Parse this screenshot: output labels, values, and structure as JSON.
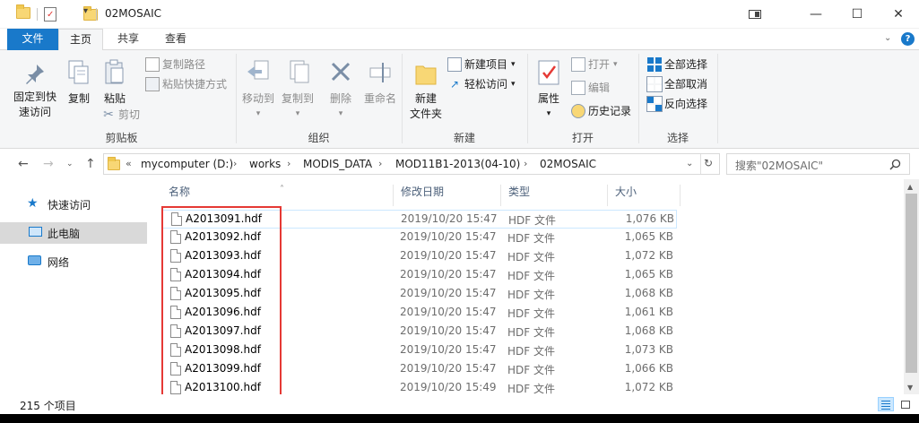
{
  "window": {
    "title": "02MOSAIC",
    "controls": {
      "minimize": "—",
      "maximize": "☐",
      "close": "✕"
    }
  },
  "ribbon_tabs": [
    {
      "label": "文件"
    },
    {
      "label": "主页"
    },
    {
      "label": "共享"
    },
    {
      "label": "查看"
    }
  ],
  "ribbon": {
    "clipboard": {
      "pin": "固定到快\n速访问",
      "pin_line1": "固定到快",
      "pin_line2": "速访问",
      "copy": "复制",
      "paste": "粘贴",
      "copy_path": "复制路径",
      "paste_shortcut": "粘贴快捷方式",
      "cut": "剪切",
      "group": "剪贴板"
    },
    "organize": {
      "move_to": "移动到",
      "copy_to": "复制到",
      "delete": "删除",
      "rename": "重命名",
      "group": "组织"
    },
    "new": {
      "new_folder_line1": "新建",
      "new_folder_line2": "文件夹",
      "new_item": "新建项目",
      "easy_access": "轻松访问",
      "group": "新建"
    },
    "open": {
      "properties": "属性",
      "open": "打开",
      "edit": "编辑",
      "history": "历史记录",
      "group": "打开"
    },
    "select": {
      "select_all": "全部选择",
      "select_none": "全部取消",
      "invert": "反向选择",
      "group": "选择"
    }
  },
  "address": {
    "prefix": "«",
    "crumbs": [
      "mycomputer (D:)",
      "works",
      "MODIS_DATA",
      "MOD11B1-2013(04-10)",
      "02MOSAIC"
    ]
  },
  "search": {
    "placeholder": "搜索\"02MOSAIC\""
  },
  "nav_pane": [
    {
      "label": "快速访问",
      "icon": "star-icon"
    },
    {
      "label": "此电脑",
      "icon": "computer-icon"
    },
    {
      "label": "网络",
      "icon": "network-icon"
    }
  ],
  "columns": {
    "name": "名称",
    "date": "修改日期",
    "type": "类型",
    "size": "大小"
  },
  "files": [
    {
      "name": "A2013091.hdf",
      "date": "2019/10/20 15:47",
      "type": "HDF 文件",
      "size": "1,076 KB"
    },
    {
      "name": "A2013092.hdf",
      "date": "2019/10/20 15:47",
      "type": "HDF 文件",
      "size": "1,065 KB"
    },
    {
      "name": "A2013093.hdf",
      "date": "2019/10/20 15:47",
      "type": "HDF 文件",
      "size": "1,072 KB"
    },
    {
      "name": "A2013094.hdf",
      "date": "2019/10/20 15:47",
      "type": "HDF 文件",
      "size": "1,065 KB"
    },
    {
      "name": "A2013095.hdf",
      "date": "2019/10/20 15:47",
      "type": "HDF 文件",
      "size": "1,068 KB"
    },
    {
      "name": "A2013096.hdf",
      "date": "2019/10/20 15:47",
      "type": "HDF 文件",
      "size": "1,061 KB"
    },
    {
      "name": "A2013097.hdf",
      "date": "2019/10/20 15:47",
      "type": "HDF 文件",
      "size": "1,068 KB"
    },
    {
      "name": "A2013098.hdf",
      "date": "2019/10/20 15:47",
      "type": "HDF 文件",
      "size": "1,073 KB"
    },
    {
      "name": "A2013099.hdf",
      "date": "2019/10/20 15:47",
      "type": "HDF 文件",
      "size": "1,066 KB"
    },
    {
      "name": "A2013100.hdf",
      "date": "2019/10/20 15:49",
      "type": "HDF 文件",
      "size": "1,072 KB"
    }
  ],
  "status": {
    "count": "215 个项目"
  },
  "colors": {
    "accent": "#1979ca",
    "highlight_box": "#e53935",
    "selection": "#cce8ff"
  }
}
